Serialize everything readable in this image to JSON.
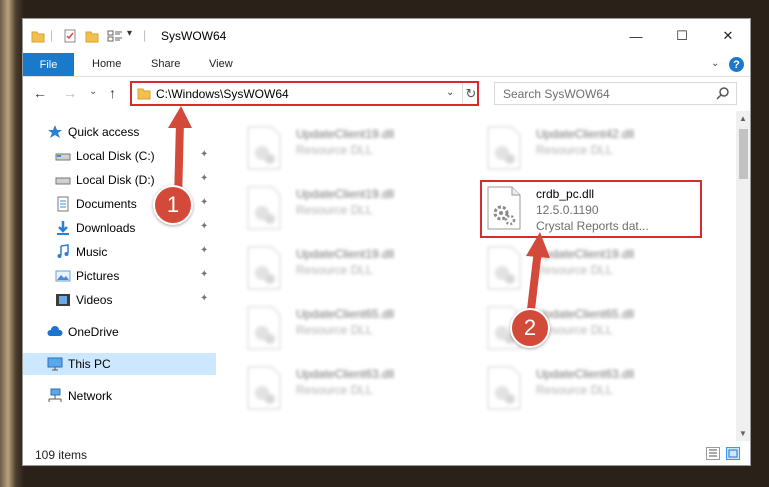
{
  "window": {
    "title": "SysWOW64",
    "minimize_glyph": "—",
    "maximize_glyph": "☐",
    "close_glyph": "✕"
  },
  "ribbon": {
    "file_label": "File",
    "tabs": [
      "Home",
      "Share",
      "View"
    ],
    "collapse_glyph": "⌄",
    "help_glyph": "?"
  },
  "nav": {
    "back_glyph": "←",
    "forward_glyph": "→",
    "recent_glyph": "⌄",
    "up_glyph": "↑",
    "address": "C:\\Windows\\SysWOW64",
    "dropdown_glyph": "⌄",
    "refresh_glyph": "↻",
    "search_placeholder": "Search SysWOW64"
  },
  "sidebar": {
    "pin_glyph": "✦",
    "items": [
      {
        "label": "Quick access",
        "icon": "star-icon",
        "pinned": false
      },
      {
        "label": "Local Disk (C:)",
        "icon": "drive-icon",
        "pinned": true
      },
      {
        "label": "Local Disk (D:)",
        "icon": "drive-icon",
        "pinned": true
      },
      {
        "label": "Documents",
        "icon": "documents-icon",
        "pinned": true
      },
      {
        "label": "Downloads",
        "icon": "downloads-icon",
        "pinned": true
      },
      {
        "label": "Music",
        "icon": "music-icon",
        "pinned": true
      },
      {
        "label": "Pictures",
        "icon": "pictures-icon",
        "pinned": true
      },
      {
        "label": "Videos",
        "icon": "videos-icon",
        "pinned": true
      },
      {
        "label": "OneDrive",
        "icon": "onedrive-icon",
        "pinned": false
      },
      {
        "label": "This PC",
        "icon": "this-pc-icon",
        "pinned": false,
        "selected": true
      },
      {
        "label": "Network",
        "icon": "network-icon",
        "pinned": false
      }
    ]
  },
  "files": [
    {
      "name": "UpdateClient19.dll",
      "desc": "Resource DLL",
      "blurred": true
    },
    {
      "name": "UpdateClient42.dll",
      "desc": "Resource DLL",
      "blurred": true
    },
    {
      "name": "UpdateClient19.dll",
      "desc": "Resource DLL",
      "blurred": true
    },
    {
      "name": "crdb_pc.dll",
      "version": "12.5.0.1190",
      "desc": "Crystal Reports dat...",
      "blurred": false
    },
    {
      "name": "UpdateClient19.dll",
      "desc": "Resource DLL",
      "blurred": true
    },
    {
      "name": "UpdateClient19.dll",
      "desc": "Resource DLL",
      "blurred": true
    },
    {
      "name": "UpdateClient65.dll",
      "desc": "Resource DLL",
      "blurred": true
    },
    {
      "name": "UpdateClient65.dll",
      "desc": "Resource DLL",
      "blurred": true
    },
    {
      "name": "UpdateClient63.dll",
      "desc": "Resource DLL",
      "blurred": true
    },
    {
      "name": "UpdateClient63.dll",
      "desc": "Resource DLL",
      "blurred": true
    }
  ],
  "status": {
    "item_count": "109 items"
  },
  "annotations": {
    "step1": "1",
    "step2": "2"
  },
  "colors": {
    "accent": "#1979ca",
    "highlight": "#d92b2b",
    "badge": "#d34a3a",
    "selection": "#cce8ff"
  }
}
